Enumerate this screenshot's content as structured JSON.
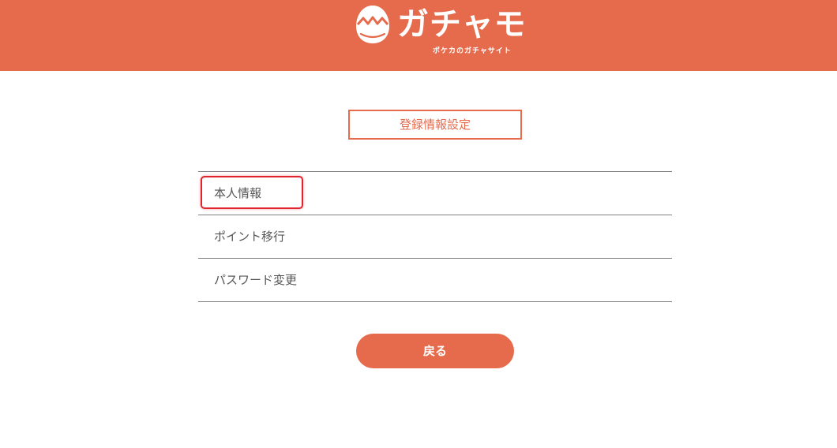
{
  "header": {
    "logo_text": "ガチャモ",
    "logo_subtitle": "ポケカのガチャサイト",
    "background_color": "#e66a4c",
    "logo_icon": "cracked-egg-icon"
  },
  "main": {
    "section_title": "登録情報設定",
    "menu_items": [
      {
        "label": "本人情報",
        "highlighted": true
      },
      {
        "label": "ポイント移行",
        "highlighted": false
      },
      {
        "label": "パスワード変更",
        "highlighted": false
      }
    ],
    "back_button_label": "戻る"
  },
  "colors": {
    "accent": "#e66a4c",
    "highlight_border": "#e0242e",
    "divider": "#808080",
    "text": "#555555"
  }
}
